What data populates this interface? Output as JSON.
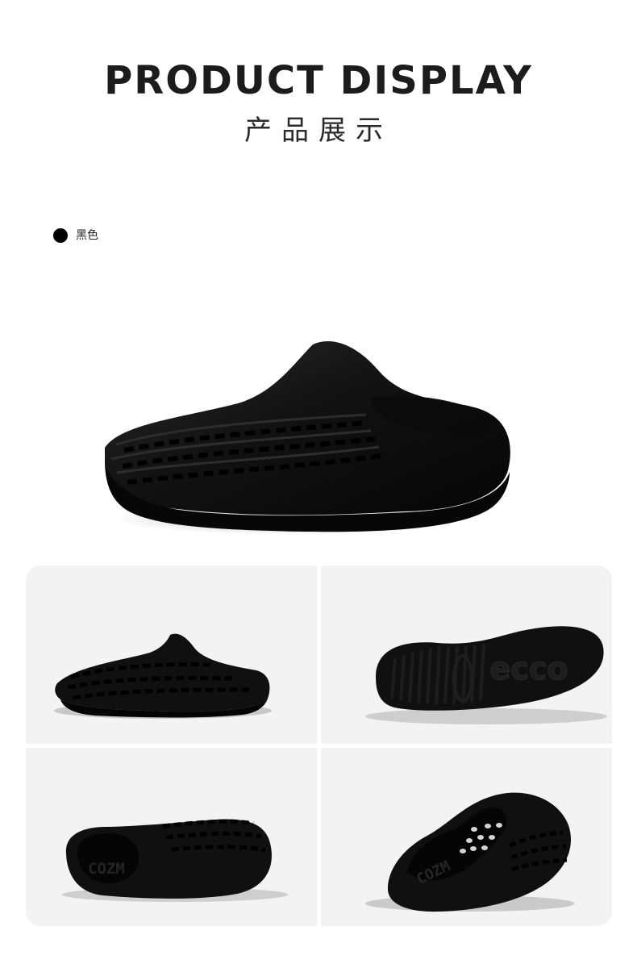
{
  "header": {
    "title_en": "PRODUCT DISPLAY",
    "title_cn": "产品展示"
  },
  "color_option": {
    "label": "黑色",
    "swatch": "#000000"
  },
  "gallery": {
    "sole_logo_text": "ecco",
    "insole_text_front": "COZM",
    "insole_text_back": "COZM"
  },
  "colors": {
    "title": "#1c1c1c",
    "tile_background": "#f3f3f3",
    "product": "#111111"
  }
}
